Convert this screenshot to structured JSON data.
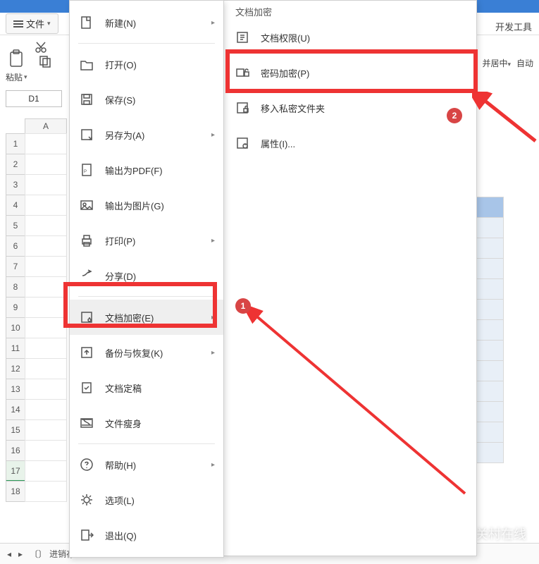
{
  "ribbon": {
    "file_label": "文件",
    "paste_label": "粘贴",
    "devtools_label": "开发工具",
    "merge_center_label": "并居中",
    "auto_label": "自动"
  },
  "namebox": {
    "value": "D1"
  },
  "column_headers": [
    "A"
  ],
  "rows": [
    "1",
    "2",
    "3",
    "4",
    "5",
    "6",
    "7",
    "8",
    "9",
    "10",
    "11",
    "12",
    "13",
    "14",
    "15",
    "16",
    "17",
    "18"
  ],
  "file_menu": {
    "items": [
      {
        "label": "新建(N)",
        "arrow": true,
        "icon": "new"
      },
      {
        "label": "打开(O)",
        "arrow": false,
        "icon": "open"
      },
      {
        "label": "保存(S)",
        "arrow": false,
        "icon": "save"
      },
      {
        "label": "另存为(A)",
        "arrow": true,
        "icon": "saveas"
      },
      {
        "label": "输出为PDF(F)",
        "arrow": false,
        "icon": "pdf"
      },
      {
        "label": "输出为图片(G)",
        "arrow": false,
        "icon": "image"
      },
      {
        "label": "打印(P)",
        "arrow": true,
        "icon": "print"
      },
      {
        "label": "分享(D)",
        "arrow": false,
        "icon": "share"
      },
      {
        "label": "文档加密(E)",
        "arrow": true,
        "icon": "encrypt",
        "highlighted": true
      },
      {
        "label": "备份与恢复(K)",
        "arrow": true,
        "icon": "backup"
      },
      {
        "label": "文档定稿",
        "arrow": false,
        "icon": "final"
      },
      {
        "label": "文件瘦身",
        "arrow": false,
        "icon": "compress"
      },
      {
        "label": "帮助(H)",
        "arrow": true,
        "icon": "help"
      },
      {
        "label": "选项(L)",
        "arrow": false,
        "icon": "options"
      },
      {
        "label": "退出(Q)",
        "arrow": false,
        "icon": "exit"
      }
    ],
    "separators_after": [
      0,
      7,
      11
    ]
  },
  "submenu": {
    "title": "文档加密",
    "items": [
      {
        "label": "文档权限(U)",
        "icon": "perm"
      },
      {
        "label": "密码加密(P)",
        "icon": "pwd"
      },
      {
        "label": "移入私密文件夹",
        "icon": "private"
      },
      {
        "label": "属性(I)...",
        "icon": "props"
      }
    ]
  },
  "markers": {
    "one": "1",
    "two": "2"
  },
  "bottom": {
    "sheet_tab": "进销存"
  },
  "watermark": "中关村在线"
}
